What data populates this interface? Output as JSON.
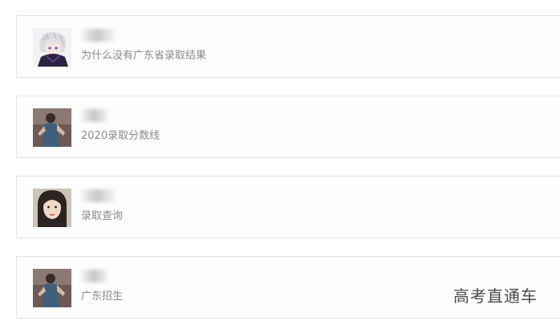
{
  "comments": [
    {
      "avatar_icon": "anime-character-avatar-icon",
      "text": "为什么没有广东省录取结果"
    },
    {
      "avatar_icon": "person-photo-avatar-icon",
      "text": "2020录取分数线"
    },
    {
      "avatar_icon": "woman-portrait-avatar-icon",
      "text": "录取查询"
    },
    {
      "avatar_icon": "person-photo-avatar-icon",
      "text": "广东招生"
    }
  ],
  "watermark": "高考直通车"
}
